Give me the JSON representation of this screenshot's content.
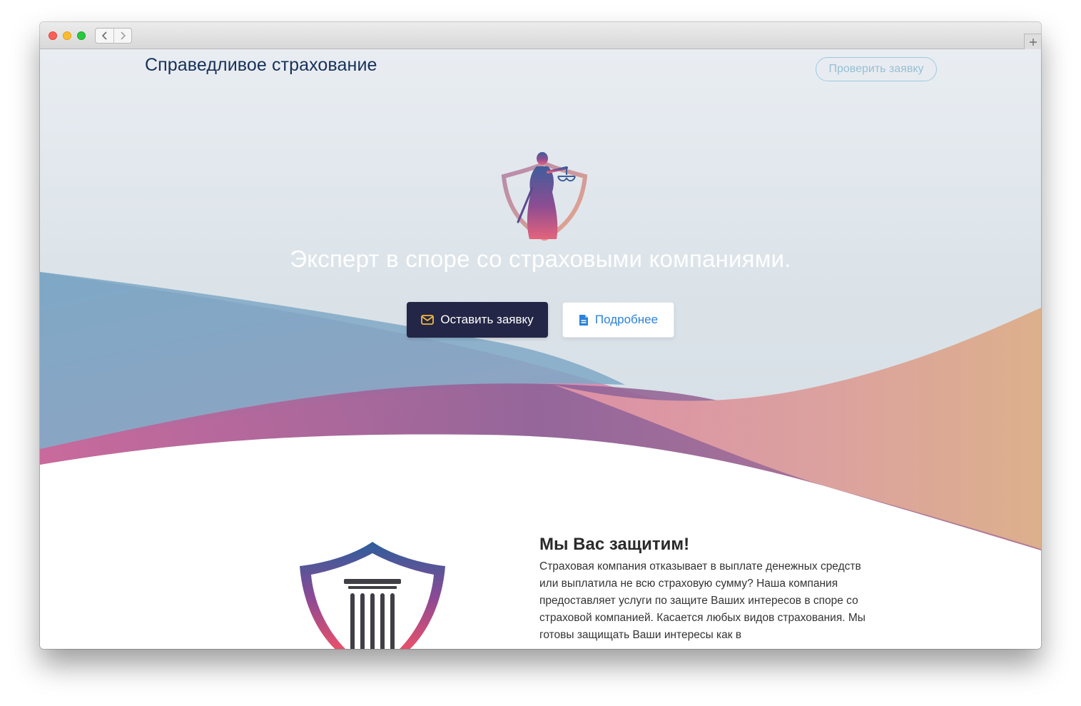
{
  "browser": {
    "back_icon": "chevron-left-icon",
    "forward_icon": "chevron-right-icon",
    "new_tab_icon": "plus-icon"
  },
  "header": {
    "brand": "Справедливое страхование",
    "check_button": "Проверить заявку"
  },
  "hero": {
    "logo_icon": "themis-justice-icon",
    "title": "Эксперт в споре со страховыми компаниями.",
    "primary_button": {
      "label": "Оставить заявку",
      "icon": "envelope-icon"
    },
    "secondary_button": {
      "label": "Подробнее",
      "icon": "document-icon"
    }
  },
  "about": {
    "logo_icon": "shield-column-icon",
    "title": "Мы Вас защитим!",
    "text": "Страховая компания отказывает в выплате денежных средств или выплатила не всю страховую сумму? Наша компания предоставляет услуги по защите Ваших интересов в споре со страховой компанией. Касается любых видов страхования. Мы готовы защищать Ваши интересы как в"
  },
  "colors": {
    "brand": "#17315b",
    "primary_button": "#232646",
    "link": "#2b82d9",
    "gradient_blue": "#7aa7c9",
    "gradient_pink": "#d97fa9",
    "gradient_purple": "#8b5c9c",
    "gradient_peach": "#dcae8c"
  }
}
